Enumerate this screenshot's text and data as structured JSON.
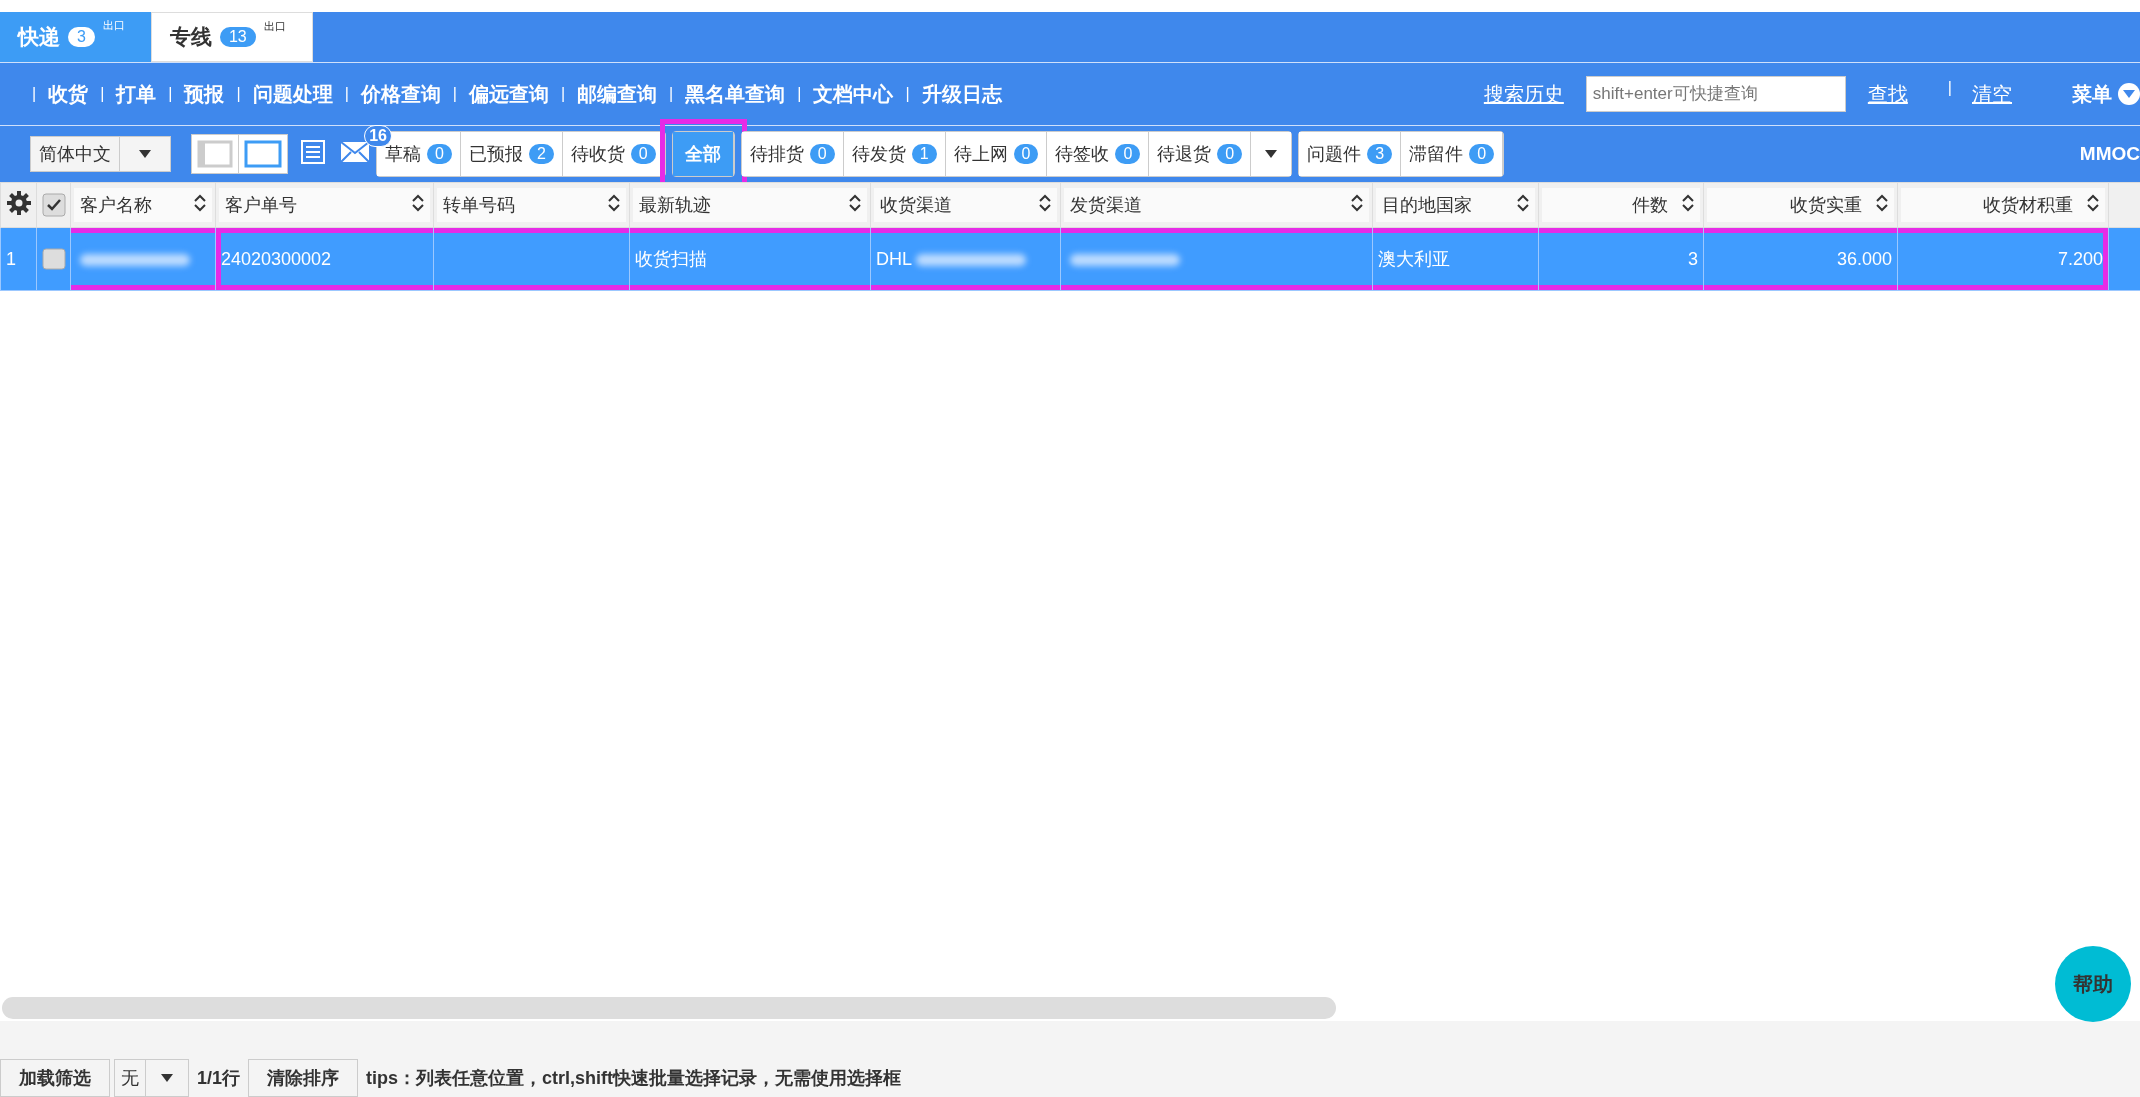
{
  "module_tabs": [
    {
      "label": "快递",
      "count": "3",
      "tag": "出口",
      "selected": false
    },
    {
      "label": "专线",
      "count": "13",
      "tag": "出口",
      "selected": true
    }
  ],
  "nav": {
    "separator": "|",
    "items": [
      "收货",
      "打单",
      "预报",
      "问题处理",
      "价格查询",
      "偏远查询",
      "邮编查询",
      "黑名单查询",
      "文档中心",
      "升级日志"
    ],
    "search_history": "搜索历史",
    "search_placeholder": "shift+enter可快捷查询",
    "find": "查找",
    "clear": "清空",
    "menu": "菜单"
  },
  "toolbar": {
    "language": "简体中文",
    "mail_count": "16",
    "user": "MMOC",
    "status_groups": [
      {
        "dropdown": false,
        "items": [
          {
            "label": "草稿",
            "count": "0",
            "selected": false,
            "highlighted": false
          },
          {
            "label": "已预报",
            "count": "2",
            "selected": false,
            "highlighted": false
          },
          {
            "label": "待收货",
            "count": "0",
            "selected": false,
            "highlighted": false
          }
        ]
      },
      {
        "dropdown": false,
        "items": [
          {
            "label": "全部",
            "selected": true,
            "highlighted": true
          }
        ]
      },
      {
        "dropdown": true,
        "items": [
          {
            "label": "待排货",
            "count": "0",
            "selected": false,
            "highlighted": false
          },
          {
            "label": "待发货",
            "count": "1",
            "selected": false,
            "highlighted": false
          },
          {
            "label": "待上网",
            "count": "0",
            "selected": false,
            "highlighted": false
          },
          {
            "label": "待签收",
            "count": "0",
            "selected": false,
            "highlighted": false
          },
          {
            "label": "待退货",
            "count": "0",
            "selected": false,
            "highlighted": false
          }
        ]
      },
      {
        "dropdown": false,
        "items": [
          {
            "label": "问题件",
            "count": "3",
            "selected": false,
            "highlighted": false
          },
          {
            "label": "滞留件",
            "count": "0",
            "selected": false,
            "highlighted": false
          }
        ]
      }
    ]
  },
  "table": {
    "columns": [
      {
        "label": "客户名称",
        "kind": "text"
      },
      {
        "label": "客户单号",
        "kind": "text"
      },
      {
        "label": "转单号码",
        "kind": "text"
      },
      {
        "label": "最新轨迹",
        "kind": "text"
      },
      {
        "label": "收货渠道",
        "kind": "text"
      },
      {
        "label": "发货渠道",
        "kind": "text"
      },
      {
        "label": "目的地国家",
        "kind": "text"
      },
      {
        "label": "件数",
        "kind": "number"
      },
      {
        "label": "收货实重",
        "kind": "number"
      },
      {
        "label": "收货材积重",
        "kind": "number"
      }
    ],
    "rows": [
      {
        "index": "1",
        "selected": true,
        "highlighted": true,
        "cells": [
          {
            "redacted": true
          },
          {
            "text": "24020300002"
          },
          {},
          {
            "text": "收货扫描"
          },
          {
            "text": "DHL",
            "redacted": true
          },
          {
            "redacted": true
          },
          {
            "text": "澳大利亚"
          },
          {
            "text": "3"
          },
          {
            "text": "36.000"
          },
          {
            "text": "7.200"
          }
        ]
      }
    ]
  },
  "footer": {
    "load_filter": "加载筛选",
    "filter_select": "无",
    "row_count": "1/1行",
    "clear_sort": "清除排序",
    "tips": "tips：列表任意位置，ctrl,shift快速批量选择记录，无需使用选择框"
  },
  "help": "帮助"
}
